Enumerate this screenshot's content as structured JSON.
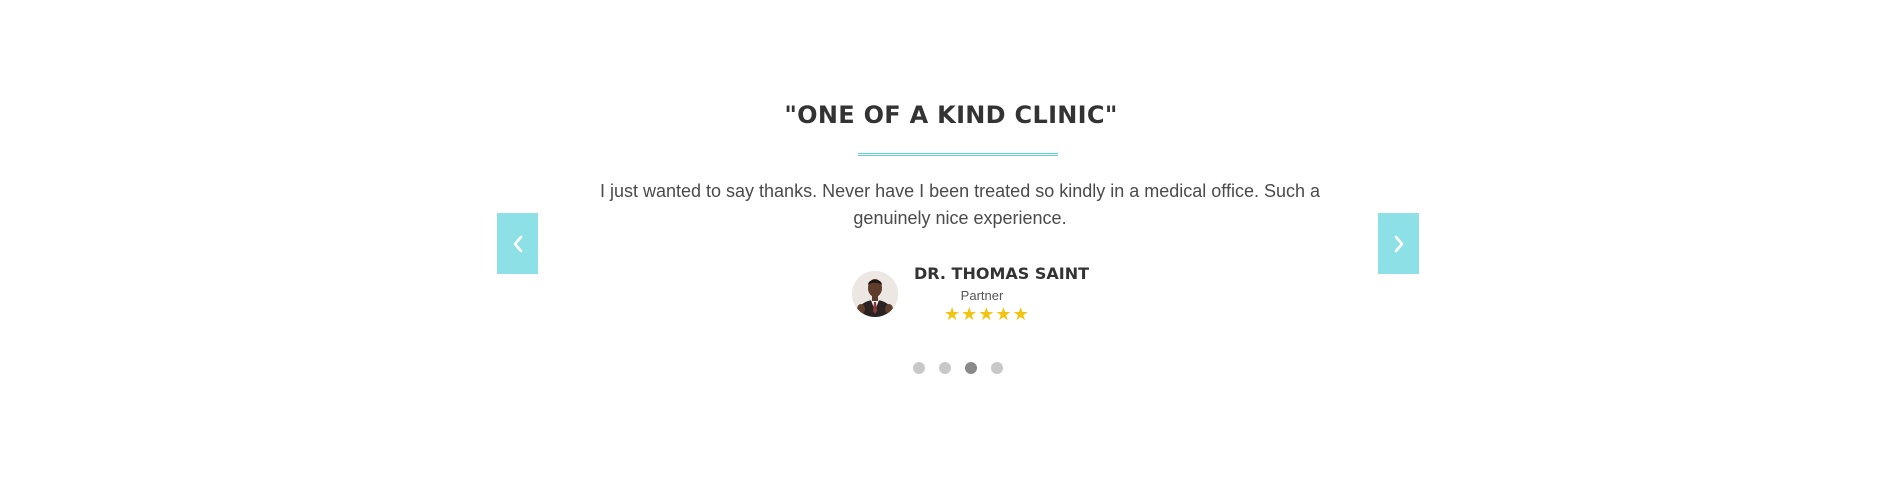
{
  "testimonial": {
    "heading": "\"ONE OF A KIND CLINIC\"",
    "quote": "I just wanted to say thanks. Never have I been treated so kindly in a medical office. Such a genuinely nice experience.",
    "author": {
      "name": "DR. THOMAS SAINT",
      "role": "Partner",
      "rating": 5,
      "stars": [
        "★",
        "★",
        "★",
        "★",
        "★"
      ]
    }
  },
  "navigation": {
    "prev_icon": "chevron-left-icon",
    "next_icon": "chevron-right-icon",
    "pagination": {
      "total": 4,
      "active_index": 2
    }
  },
  "colors": {
    "accent": "#8de0e6",
    "divider": "#5fcfd8",
    "star": "#f2c40f",
    "dot": "#c8c8c8",
    "dot_active": "#8a8a8a"
  }
}
